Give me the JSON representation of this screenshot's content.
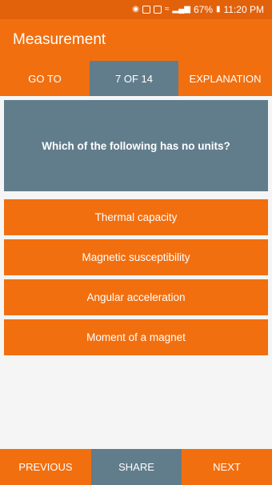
{
  "status_bar": {
    "battery": "67%",
    "time": "11:20 PM"
  },
  "app_bar": {
    "title": "Measurement"
  },
  "nav": {
    "goto_label": "GO TO",
    "counter": "7 OF 14",
    "explanation_label": "EXPLANATION"
  },
  "question": {
    "text": "Which of the following has no units?"
  },
  "options": [
    {
      "label": "Thermal capacity"
    },
    {
      "label": "Magnetic susceptibility"
    },
    {
      "label": "Angular acceleration"
    },
    {
      "label": "Moment of a magnet"
    }
  ],
  "bottom": {
    "previous_label": "PREVIOUS",
    "share_label": "SHARE",
    "next_label": "NEXT"
  },
  "colors": {
    "accent": "#f26f0f",
    "status": "#e2620c",
    "slate": "#617d8c"
  }
}
